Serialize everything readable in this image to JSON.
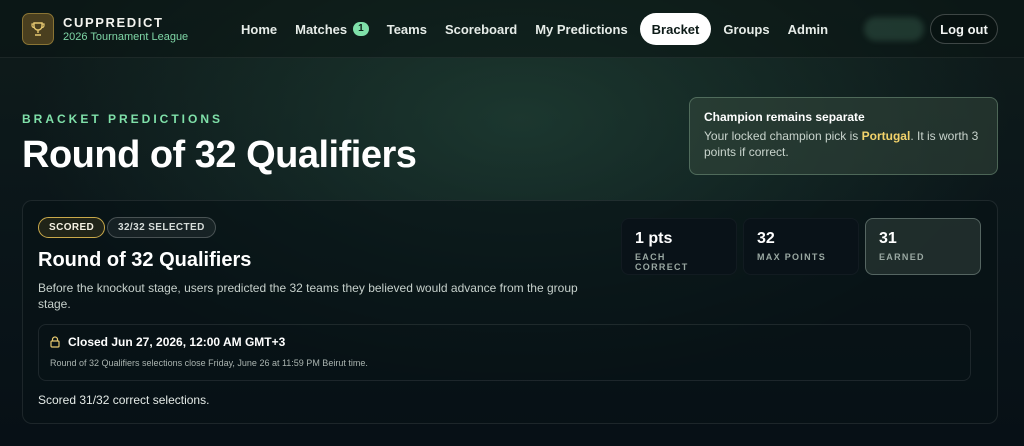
{
  "brand": {
    "name": "CUPPREDICT",
    "subtitle": "2026 Tournament League",
    "icon": "trophy-icon"
  },
  "nav": {
    "items": [
      {
        "label": "Home",
        "active": false
      },
      {
        "label": "Matches",
        "badge": "1",
        "active": false
      },
      {
        "label": "Teams",
        "active": false
      },
      {
        "label": "Scoreboard",
        "active": false
      },
      {
        "label": "My Predictions",
        "active": false
      },
      {
        "label": "Bracket",
        "active": true
      },
      {
        "label": "Groups",
        "active": false
      },
      {
        "label": "Admin",
        "active": false
      }
    ],
    "logout_label": "Log out"
  },
  "header": {
    "eyebrow": "BRACKET PREDICTIONS",
    "title": "Round of 32 Qualifiers"
  },
  "champion": {
    "title": "Champion remains separate",
    "text_before": "Your locked champion pick is ",
    "team": "Portugal",
    "text_after": ". It is worth 3 points if correct."
  },
  "round": {
    "status_pill": "SCORED",
    "selected_pill": "32/32 SELECTED",
    "title": "Round of 32 Qualifiers",
    "description": "Before the knockout stage, users predicted the 32 teams they believed would advance from the group stage.",
    "stats": [
      {
        "value": "1 pts",
        "label": "EACH CORRECT"
      },
      {
        "value": "32",
        "label": "MAX POINTS"
      },
      {
        "value": "31",
        "label": "EARNED"
      }
    ],
    "lock": {
      "title": "Closed Jun 27, 2026, 12:00 AM GMT+3",
      "subtitle": "Round of 32 Qualifiers selections close Friday, June 26 at 11:59 PM Beirut time."
    },
    "result_text": "Scored 31/32 correct selections."
  },
  "colors": {
    "accent": "#7fe0a9",
    "gold": "#f3d36b",
    "background": "#0a1519"
  }
}
